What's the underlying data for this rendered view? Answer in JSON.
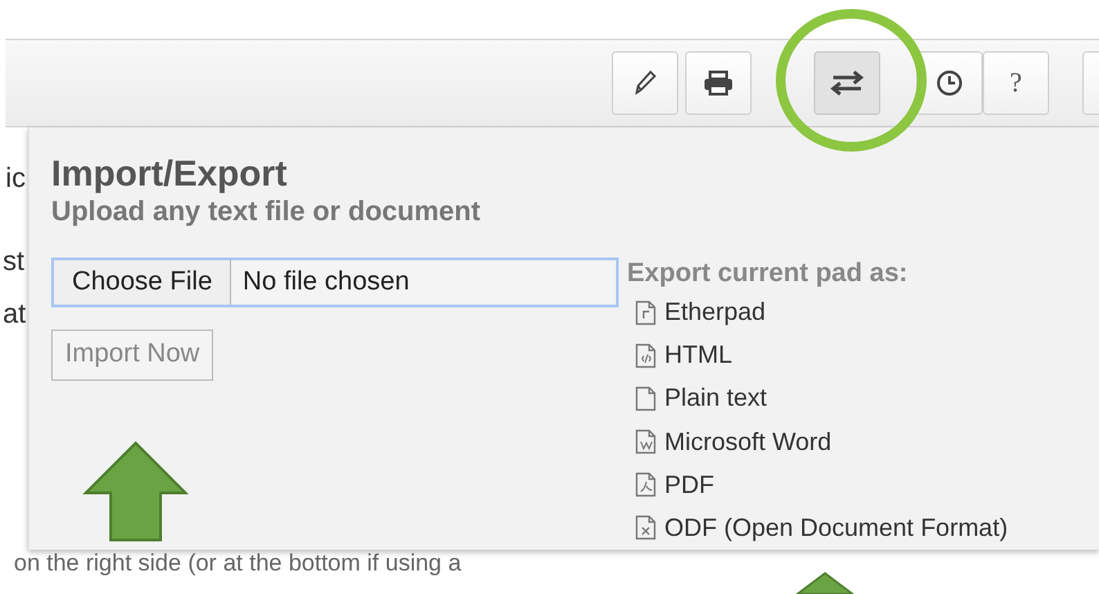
{
  "toolbar": {
    "buttons": [
      {
        "kind": "pencil",
        "selected": false
      },
      {
        "kind": "print",
        "selected": false
      },
      {
        "kind": "import-export",
        "selected": true
      },
      {
        "kind": "clock",
        "selected": false
      },
      {
        "kind": "help",
        "label": "?",
        "selected": false
      },
      {
        "kind": "partial",
        "selected": false
      }
    ]
  },
  "pad_text": {
    "fragments": [
      "ic",
      "st",
      "at"
    ],
    "bottom_line": "on the right side (or at the bottom if using a"
  },
  "import_export": {
    "title": "Import/Export",
    "subtitle": "Upload any text file or document",
    "choose_file": "Choose File",
    "file_status": "No file chosen",
    "import_button": "Import Now",
    "export_heading": "Export current pad as:",
    "export_formats": [
      {
        "kind": "etherpad",
        "label": "Etherpad"
      },
      {
        "kind": "html",
        "label": "HTML"
      },
      {
        "kind": "text",
        "label": "Plain text"
      },
      {
        "kind": "word",
        "label": "Microsoft Word"
      },
      {
        "kind": "pdf",
        "label": "PDF"
      },
      {
        "kind": "odf",
        "label": "ODF (Open Document Format)"
      }
    ]
  }
}
